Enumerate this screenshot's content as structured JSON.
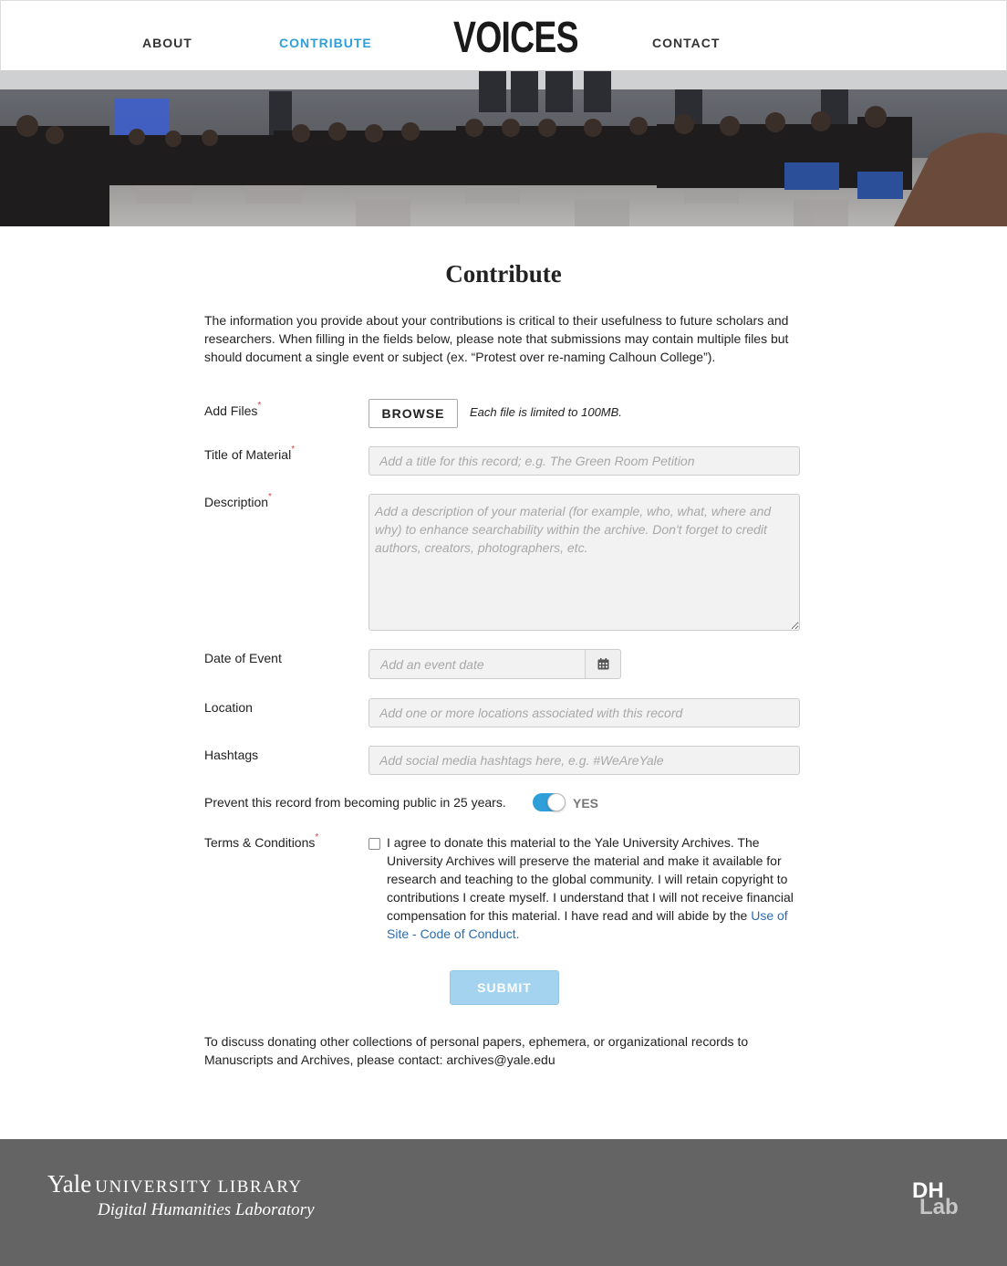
{
  "nav": {
    "about": "ABOUT",
    "contribute": "CONTRIBUTE",
    "contact": "CONTACT",
    "logo": "VOICES",
    "active_color": "#2e9fd8"
  },
  "page": {
    "title": "Contribute",
    "intro": "The information you provide about your contributions is critical to their usefulness to future scholars and researchers. When filling in the fields below, please note that submissions may contain multiple files but should document a single event or subject (ex. “Protest over re-naming Calhoun College”)."
  },
  "form": {
    "add_files_label": "Add Files",
    "browse_label": "BROWSE",
    "file_note": "Each file is limited to 100MB.",
    "title_label": "Title of Material",
    "title_placeholder": "Add a title for this record; e.g. The Green Room Petition",
    "description_label": "Description",
    "description_placeholder": "Add a description of your material (for example, who, what, where and why) to enhance searchability within the archive. Don't forget to credit authors, creators, photographers, etc.",
    "date_label": "Date of Event",
    "date_placeholder": "Add an event date",
    "location_label": "Location",
    "location_placeholder": "Add one or more locations associated with this record",
    "hashtags_label": "Hashtags",
    "hashtags_placeholder": "Add social media hashtags here, e.g. #WeAreYale",
    "prevent_label": "Prevent this record from becoming public in 25 years.",
    "toggle_value": "YES",
    "terms_label": "Terms & Conditions",
    "terms_text": "I agree to donate this material to the Yale University Archives. The University Archives will preserve the material and make it available for research and teaching to the global community. I will retain copyright to contributions I create myself. I understand that I will not receive financial compensation for this material. I have read and will abide by the ",
    "terms_link": "Use of Site - Code of Conduct.",
    "required_mark": "*",
    "submit_label": "SUBMIT"
  },
  "donate_text": "To discuss donating other collections of personal papers, ephemera, or organizational records to Manuscripts and Archives, please contact: archives@yale.edu",
  "footer": {
    "yale": "Yale",
    "library": "UNIVERSITY LIBRARY",
    "dhl": "Digital Humanities Laboratory",
    "dh_logo": "DH Lab"
  },
  "colors": {
    "accent": "#2e9fd8",
    "submit_disabled": "#a3d3ee",
    "required": "#d9433e",
    "footer_bg": "#646464"
  }
}
